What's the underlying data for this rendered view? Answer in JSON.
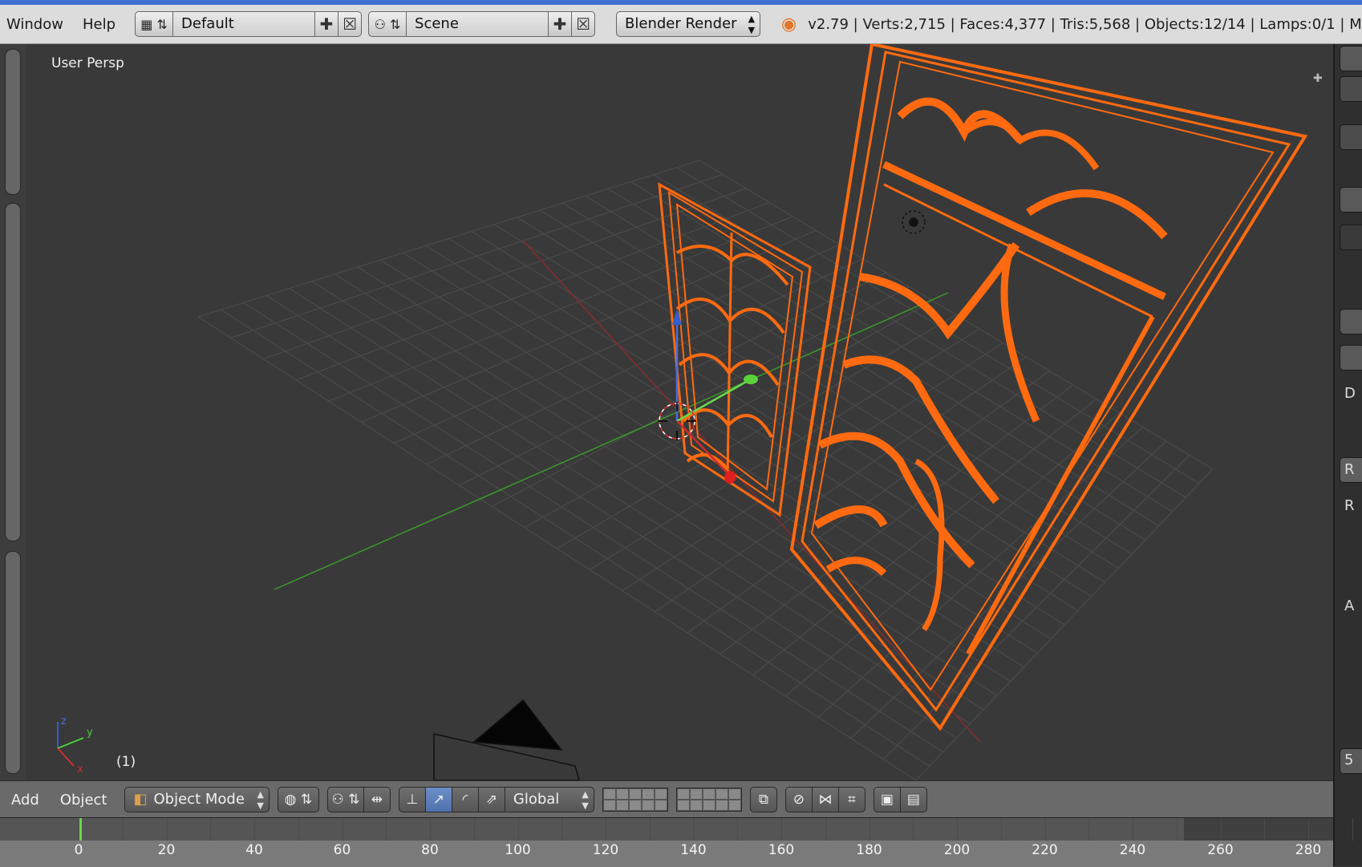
{
  "header": {
    "menus": [
      "Window",
      "Help"
    ],
    "layout_name": "Default",
    "scene_name": "Scene",
    "render_engine": "Blender Render",
    "stats": "v2.79 | Verts:2,715 | Faces:4,377 | Tris:5,568 | Objects:12/14 | Lamps:0/1 | M"
  },
  "viewport": {
    "view_label": "User Persp",
    "frame_label": "(1)",
    "axis_labels": {
      "x": "x",
      "y": "y",
      "z": "z"
    }
  },
  "bottom_header": {
    "menus": [
      "Add",
      "Object"
    ],
    "mode": "Object Mode",
    "orientation": "Global"
  },
  "right_panel": {
    "letters": [
      "D",
      "R",
      "R",
      "A",
      "5"
    ]
  },
  "timeline": {
    "ticks": [
      "0",
      "20",
      "40",
      "60",
      "80",
      "100",
      "120",
      "140",
      "160",
      "180",
      "200",
      "220",
      "240",
      "260",
      "280"
    ],
    "current_frame": 1
  },
  "colors": {
    "selection_wire": "#ff6a10",
    "grid_line": "#4d4d4d",
    "x_axis": "#8a2b2b",
    "y_axis": "#3a9a2a",
    "z_axis": "#2f5fd0",
    "viewport_bg": "#393939",
    "accent": "#3f6fd1"
  }
}
